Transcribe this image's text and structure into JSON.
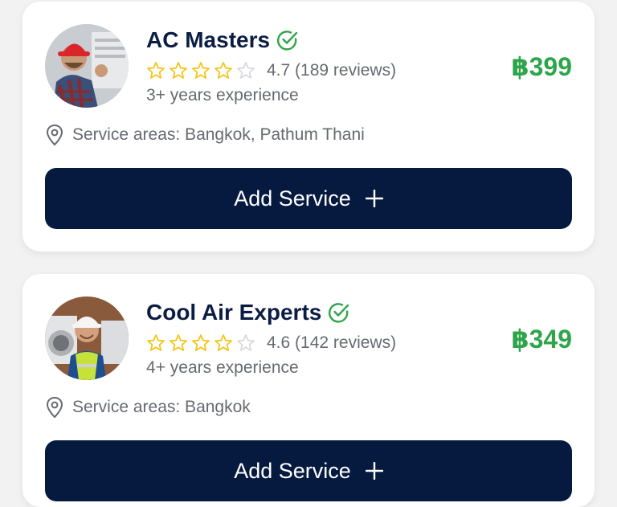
{
  "currency_color": "#2fa54b",
  "button_color": "#061a40",
  "star_color": "#f5c518",
  "providers": [
    {
      "name": "AC Masters",
      "verified": true,
      "rating": "4.7",
      "reviews": "(189 reviews)",
      "stars_filled": 4,
      "experience": "3+ years experience",
      "price": "฿399",
      "service_areas": "Service areas: Bangkok, Pathum Thani",
      "button_label": "Add Service",
      "button_icon": "plus-icon",
      "avatar": "technician-red-cap-avatar"
    },
    {
      "name": "Cool Air Experts",
      "verified": true,
      "rating": "4.6",
      "reviews": "(142 reviews)",
      "stars_filled": 4,
      "experience": "4+ years experience",
      "price": "฿349",
      "service_areas": "Service areas: Bangkok",
      "button_label": "Add Service",
      "button_icon": "plus-icon",
      "avatar": "technician-hard-hat-avatar"
    }
  ]
}
